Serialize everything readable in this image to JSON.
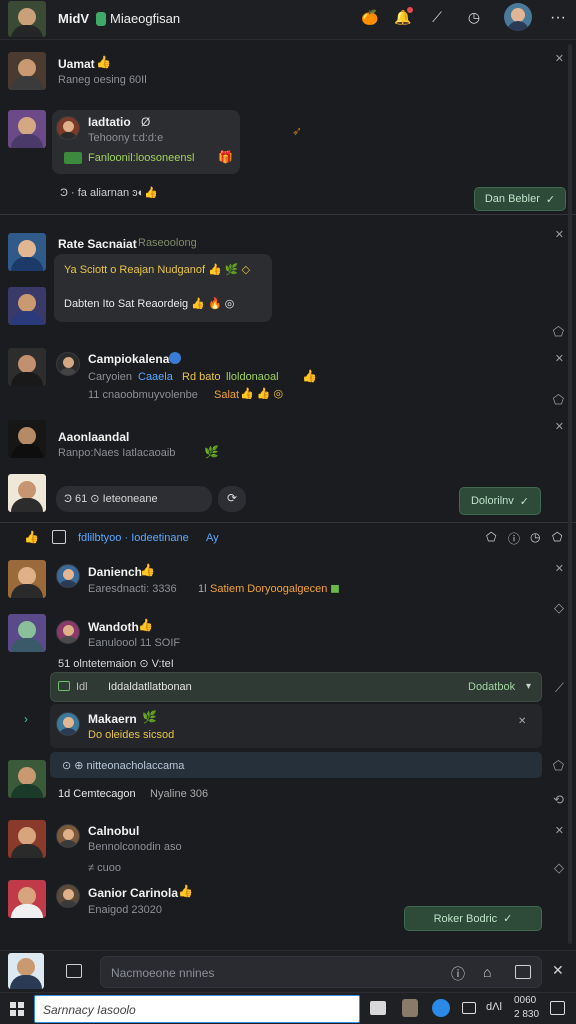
{
  "header": {
    "title": "MidV",
    "channel": "Miaeogfisan",
    "more_icon": "···"
  },
  "messages": [
    {
      "name": "Uamat",
      "emoji": "👍",
      "sub": "Raneg oesing 60Il"
    },
    {
      "name": "Iadtatio",
      "check": "Ø",
      "sub": "Tehoony t:d:d:e",
      "link": "Fanloonil:loosoneensl",
      "reactions": "Ͽ · fa aliarnan ͽ◐👍"
    }
  ],
  "first_action": {
    "label": "Dan Bebler",
    "check": "✓"
  },
  "section2": {
    "name": "Rate Sacnaiat",
    "name_suffix": "Raseoolong",
    "line1": "Ya Sciott o Reajan Nudganof 👍 🌿 ◇",
    "line2": "Dabten Ito Sat Reaordeig 👍 🔥 ◎"
  },
  "msg3": {
    "name": "Campiokalena",
    "line1a": "Caryoien",
    "line1b": "Caaela",
    "line1c": "Rd bato",
    "line1d": "lloldonaoal",
    "line2a": "11 cnaoobmuyvolenbe",
    "line2b": "Salat",
    "line2c": "👍 👍 ◎"
  },
  "msg4": {
    "name": "Aaonlaandal",
    "sub": "Ranpo:Naes Iatlacaoaib",
    "leaf": "🌿"
  },
  "msg5": {
    "pill_text": "Ͽ 61 ⊙ Ieteoneane",
    "refresh": "⟳",
    "btn": "Dolorilnv"
  },
  "thread": {
    "label": "fdlilbtyoo · Iodeetinane",
    "tag": "Ay"
  },
  "msg6": {
    "name": "Daniench",
    "sub": "Earesdnacti: 3336",
    "extra_a": "1l",
    "extra_b": "Satiem Doryoogalgecen"
  },
  "msg7": {
    "name": "Wandoth",
    "sub": "Eanuloool 11 SOIF",
    "react": "51 olntetemaion ⊙ V:teI",
    "input_label": "Idl",
    "input_value": "Iddaldatllatbonan",
    "input_btn": "Dodatbok"
  },
  "quote": {
    "name": "Makaern",
    "sub": "Do oleides sicsod"
  },
  "quote_row": {
    "text": "⊙ ⊕ nitteonacholaccama"
  },
  "msg8": {
    "text": "1d Cemtecagon",
    "count": "Nyaline 306"
  },
  "msg9": {
    "name": "Calnobul",
    "sub": "Bennolconodin aso"
  },
  "msg9_extra": {
    "text": "≠ cuoo"
  },
  "msg10": {
    "name": "Ganior Carinola",
    "sub": "Enaigod 23020",
    "btn": "Roker Bodric"
  },
  "composer": {
    "placeholder": "Nacmoeone nnines"
  },
  "taskbar": {
    "search": "Sarnnacy Iasoolo",
    "time": "0060",
    "date": "2 830",
    "cluster": "dΛl"
  },
  "colors": {
    "accent_green": "#2e4a39",
    "background": "#1b1c1f",
    "bubble": "#2c2d31"
  }
}
